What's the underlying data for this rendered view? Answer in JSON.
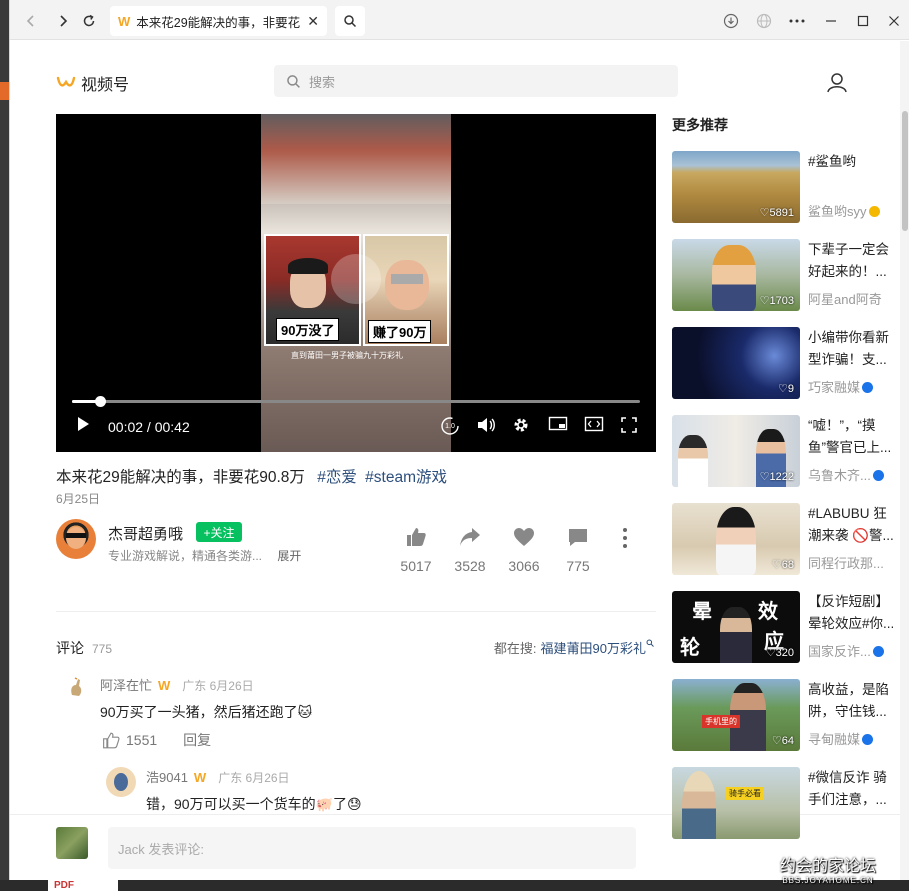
{
  "browser": {
    "tab_title": "本来花29能解决的事，非要花",
    "tab_logo": "W"
  },
  "header": {
    "brand": "视频号",
    "search_placeholder": "搜索"
  },
  "video": {
    "caption_left": "90万没了",
    "caption_right": "赚了90万",
    "subtitle": "直到莆田一男子被骗九十万彩礼",
    "time": "00:02 / 00:42",
    "progress": 0.05,
    "speed_badge": "1.0"
  },
  "info": {
    "title": "本来花29能解决的事，非要花90.8万",
    "tags": [
      "#恋爱",
      "#steam游戏"
    ],
    "date": "6月25日",
    "author": "杰哥超勇哦",
    "follow": "+关注",
    "author_desc": "专业游戏解说，精通各类游...",
    "expand": "展开",
    "stats": [
      {
        "icon": "thumbs-up-icon",
        "value": "5017"
      },
      {
        "icon": "share-icon",
        "value": "3528"
      },
      {
        "icon": "heart-icon",
        "value": "3066"
      },
      {
        "icon": "comment-icon",
        "value": "775"
      }
    ]
  },
  "comments": {
    "label": "评论",
    "count": "775",
    "also_search_label": "都在搜:",
    "also_search_query": "福建莆田90万彩礼",
    "items": [
      {
        "name": "阿泽在忙",
        "meta": "广东 6月26日",
        "text": "90万买了一头猪，然后猪还跑了🐱",
        "likes": "1551",
        "reply": "回复"
      },
      {
        "name": "浩9041",
        "meta": "广东 6月26日",
        "text": "错，90万可以买一个货车的🐖了😓"
      }
    ],
    "input_placeholder": "Jack 发表评论:"
  },
  "recommend": {
    "heading": "更多推荐",
    "items": [
      {
        "title": "#鲨鱼哟",
        "author": "鲨鱼哟syy",
        "likes": "♡5891",
        "verify": "#f5b800"
      },
      {
        "title": "下辈子一定会好起来的！...",
        "author": "阿星and阿奇",
        "likes": "♡1703",
        "verify": ""
      },
      {
        "title": "小编带你看新型诈骗！支...",
        "author": "巧家融媒",
        "likes": "♡9",
        "verify": "#1a73e8"
      },
      {
        "title": "“嘘！”，“摸鱼”警官已上...",
        "author": "乌鲁木齐...",
        "likes": "♡1222",
        "verify": "#1a73e8"
      },
      {
        "title": "#LABUBU 狂潮来袭 🚫警...",
        "author": "同程行政那...",
        "likes": "♡68",
        "verify": ""
      },
      {
        "title": "【反诈短剧】晕轮效应#你...",
        "author": "国家反诈...",
        "likes": "♡320",
        "verify": "#1a73e8"
      },
      {
        "title": "高收益，是陷阱，守住钱...",
        "author": "寻甸融媒",
        "likes": "♡64",
        "verify": "#1a73e8"
      },
      {
        "title": "#微信反诈 骑手们注意，...",
        "author": "",
        "likes": "",
        "verify": ""
      }
    ],
    "thumb_text": {
      "t6a": "晕",
      "t6b": "效",
      "t6c": "轮",
      "t6d": "应",
      "t7": "手机里的",
      "t8": "骑手必看"
    }
  },
  "desktop": {
    "pdf_label": "PDF",
    "watermark_title": "约会的家论坛",
    "watermark_url": "BBS.JOYAHOME.CN"
  }
}
